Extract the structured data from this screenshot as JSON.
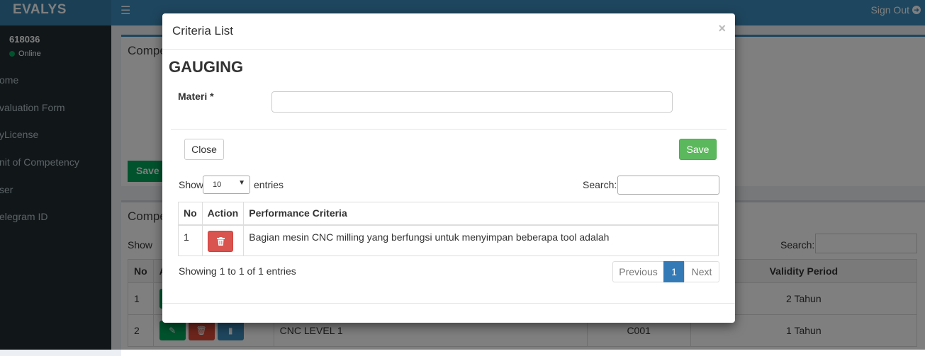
{
  "app": {
    "logo": "EVALYS",
    "signout": "Sign Out"
  },
  "user": {
    "id": "618036",
    "status": "Online"
  },
  "sidebar": {
    "items": [
      {
        "label": "ome"
      },
      {
        "label": "valuation Form"
      },
      {
        "label": "yLicense"
      },
      {
        "label": "nit of Competency"
      },
      {
        "label": "ser"
      },
      {
        "label": "elegram ID"
      }
    ]
  },
  "background": {
    "box1_title": "Compe",
    "box1_save": "Save",
    "box2_title": "Compe",
    "show_label": "Show",
    "search_label": "Search:",
    "table": {
      "headers": {
        "no": "No",
        "action": "A",
        "validity": "Validity Period"
      },
      "rows": [
        {
          "no": "1",
          "name": "",
          "code": "",
          "validity": "2 Tahun"
        },
        {
          "no": "2",
          "name": "CNC LEVEL 1",
          "code": "C001",
          "validity": "1 Tahun"
        }
      ]
    }
  },
  "modal": {
    "title": "Criteria List",
    "close_symbol": "×",
    "heading": "GAUGING",
    "materi_label": "Materi *",
    "materi_value": "",
    "close_button": "Close",
    "save_button": "Save",
    "show_label": "Show",
    "entries_value": "10",
    "entries_label": "entries",
    "search_label": "Search:",
    "search_value": "",
    "table": {
      "headers": {
        "no": "No",
        "action": "Action",
        "criteria": "Performance Criteria"
      },
      "rows": [
        {
          "no": "1",
          "criteria": "Bagian mesin CNC milling yang berfungsi untuk menyimpan beberapa tool adalah"
        }
      ]
    },
    "info": "Showing 1 to 1 of 1 entries",
    "pagination": {
      "previous": "Previous",
      "current": "1",
      "next": "Next"
    }
  },
  "colors": {
    "primary": "#3c8dbc",
    "sidebar": "#222d32",
    "success": "#5cb85c",
    "danger": "#d9534f",
    "page_active": "#337ab7"
  }
}
